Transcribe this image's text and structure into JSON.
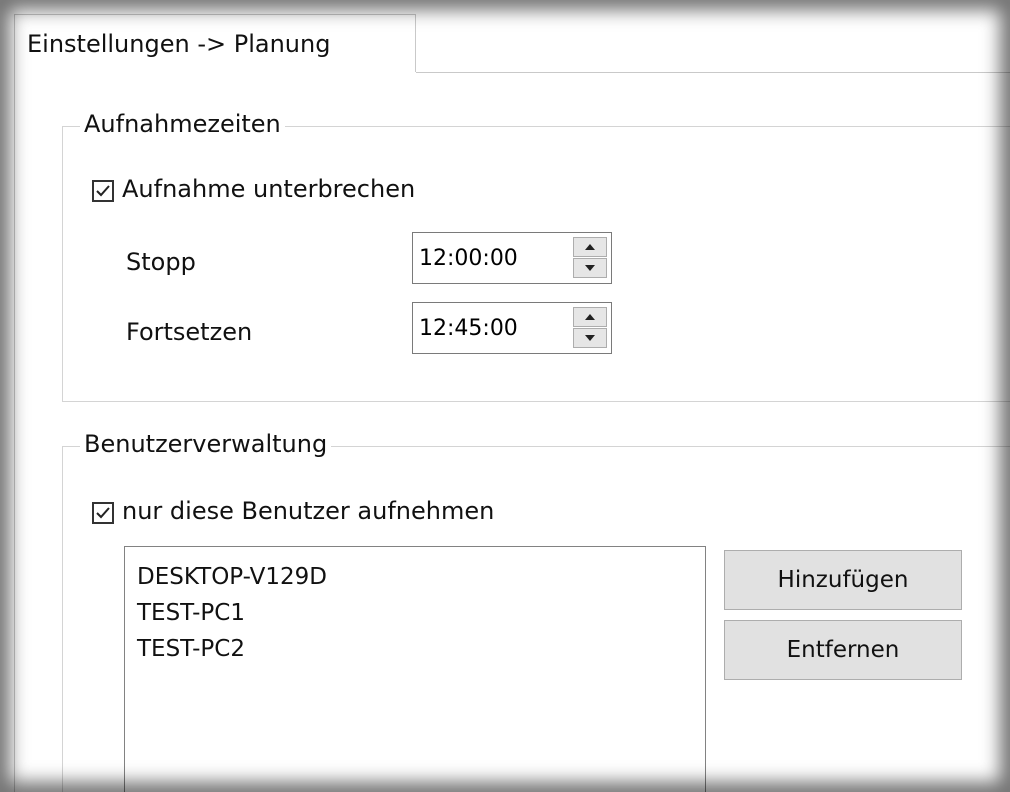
{
  "tab": {
    "label": "Einstellungen -> Planung"
  },
  "recording_times": {
    "legend": "Aufnahmezeiten",
    "interrupt_checkbox": {
      "label": "Aufnahme unterbrechen",
      "checked": true
    },
    "stop": {
      "label": "Stopp",
      "value": "12:00:00"
    },
    "resume": {
      "label": "Fortsetzen",
      "value": "12:45:00"
    }
  },
  "user_management": {
    "legend": "Benutzerverwaltung",
    "only_users_checkbox": {
      "label": "nur diese Benutzer aufnehmen",
      "checked": true
    },
    "users": [
      "DESKTOP-V129D",
      "TEST-PC1",
      "TEST-PC2"
    ],
    "add_button": "Hinzufügen",
    "remove_button": "Entfernen"
  },
  "icons": [
    "checkmark-icon",
    "spin-up-icon",
    "spin-down-icon"
  ]
}
